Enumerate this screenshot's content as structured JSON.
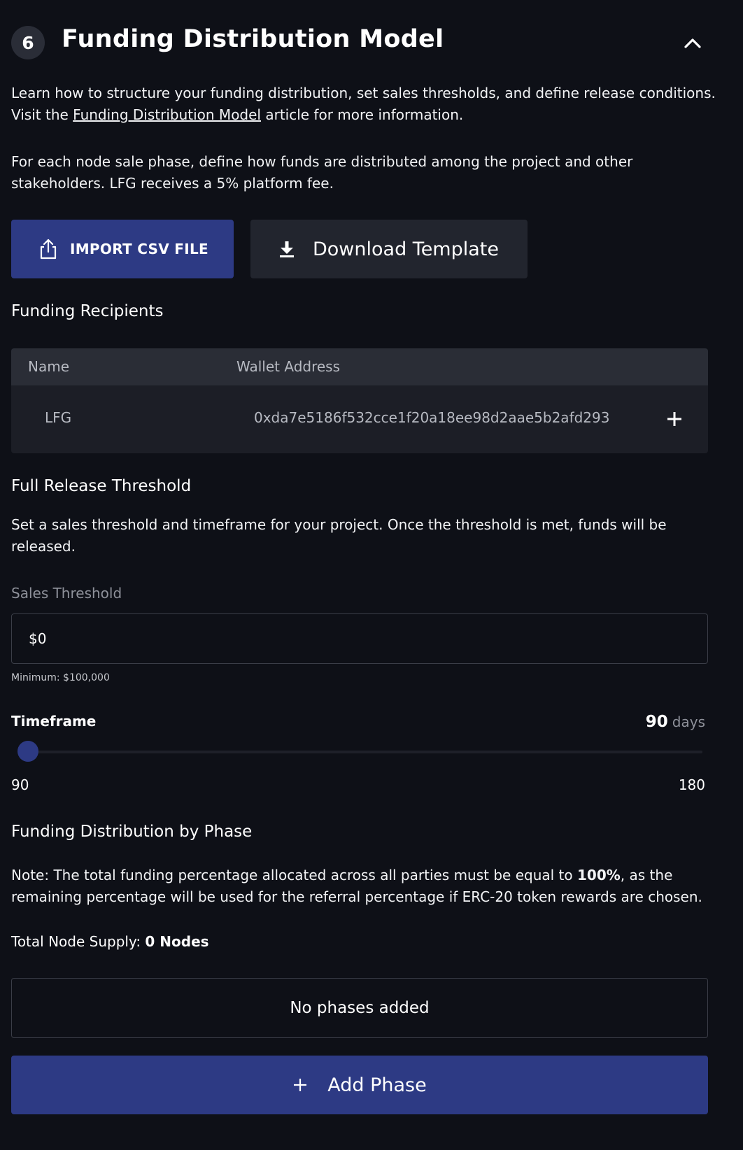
{
  "section": {
    "step_number": "6",
    "title": "Funding Distribution Model"
  },
  "intro": {
    "line1": "Learn how to structure your funding distribution, set sales thresholds, and define release conditions.",
    "line2_prefix": "Visit the ",
    "link_text": "Funding Distribution Model",
    "line2_suffix": " article for more information.",
    "desc_line1": "For each node sale phase, define how funds are distributed among the project and other",
    "desc_line2": "stakeholders. LFG receives a 5% platform fee."
  },
  "buttons": {
    "import_csv": "IMPORT CSV FILE",
    "download_template": "Download Template",
    "add_phase": "Add Phase"
  },
  "recipients": {
    "heading": "Funding Recipients",
    "columns": [
      "Name",
      "Wallet Address"
    ],
    "rows": [
      {
        "name": "LFG",
        "wallet": "0xda7e5186f532cce1f20a18ee98d2aae5b2afd293"
      }
    ]
  },
  "release": {
    "heading": "Full Release Threshold",
    "desc_line1": "Set a sales threshold and timeframe for your project. Once the threshold is met, funds will be",
    "desc_line2": "released.",
    "sales_label": "Sales Threshold",
    "sales_value": "$0",
    "sales_hint": "Minimum: $100,000",
    "timeframe_label": "Timeframe",
    "timeframe_value": "90",
    "timeframe_unit": "days",
    "slider_min": "90",
    "slider_max": "180",
    "slider_fraction": 0
  },
  "distribution": {
    "heading": "Funding Distribution by Phase",
    "note_prefix": "Note: The total funding percentage allocated across all parties must be equal to ",
    "note_bold": "100%",
    "note_suffix": ", as the",
    "note_line2": "remaining percentage will be used for the referral percentage if ERC-20 token rewards are chosen.",
    "supply_label": "Total Node Supply: ",
    "supply_value": "0 Nodes",
    "empty_text": "No phases added"
  },
  "icons": {
    "collapse": "chevron-up-icon",
    "import": "upload-icon",
    "download": "download-icon",
    "add_recipient": "plus-icon",
    "add_phase": "plus-icon"
  },
  "colors": {
    "background": "#0e1017",
    "primary": "#2d3a84",
    "secondary_button": "#22252e",
    "table_header": "#2a2d36",
    "table_body": "#1c1e26"
  }
}
